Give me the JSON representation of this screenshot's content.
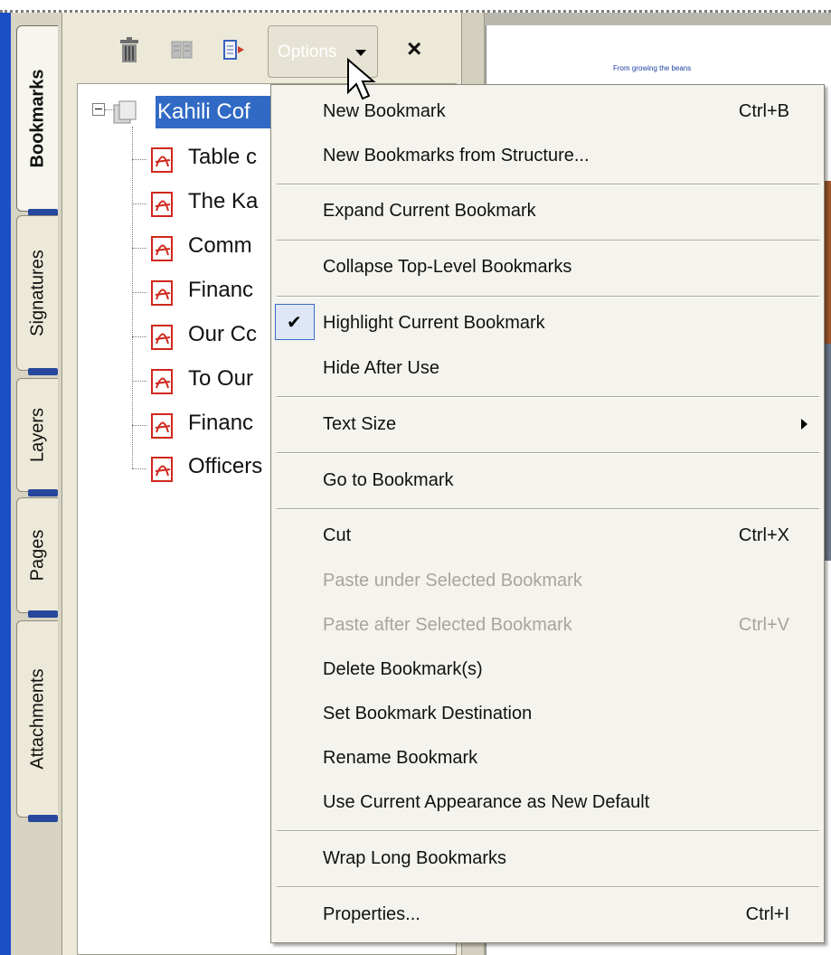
{
  "side_tabs": [
    {
      "label": "Bookmarks",
      "active": true
    },
    {
      "label": "Signatures",
      "active": false
    },
    {
      "label": "Layers",
      "active": false
    },
    {
      "label": "Pages",
      "active": false
    },
    {
      "label": "Attachments",
      "active": false
    }
  ],
  "toolbar": {
    "delete_icon": "trash-icon",
    "expand_icon": "expand-bookmark-icon",
    "new_icon": "new-bookmark-icon",
    "options_label": "Options",
    "close_label": "×"
  },
  "tree": {
    "root": {
      "label": "Kahili Cof",
      "icon": "document-icon",
      "expanded": true
    },
    "items": [
      {
        "label": "Table c"
      },
      {
        "label": "The Ka"
      },
      {
        "label": "Comm"
      },
      {
        "label": "Financ"
      },
      {
        "label": "Our Cc"
      },
      {
        "label": "To Our"
      },
      {
        "label": "Financ"
      },
      {
        "label": "Officers"
      }
    ]
  },
  "document": {
    "heading_text": "From growing the beans"
  },
  "menu": {
    "items": [
      {
        "label": "New Bookmark",
        "shortcut": "Ctrl+B"
      },
      {
        "label": "New Bookmarks from Structure...",
        "shortcut": ""
      },
      {
        "label": "Expand Current Bookmark",
        "shortcut": ""
      },
      {
        "label": "Collapse Top-Level Bookmarks",
        "shortcut": ""
      },
      {
        "label": "Highlight Current Bookmark",
        "shortcut": "",
        "checked": true
      },
      {
        "label": "Hide After Use",
        "shortcut": ""
      },
      {
        "label": "Text Size",
        "shortcut": "",
        "submenu": true
      },
      {
        "label": "Go to Bookmark",
        "shortcut": ""
      },
      {
        "label": "Cut",
        "shortcut": "Ctrl+X"
      },
      {
        "label": "Paste under Selected Bookmark",
        "shortcut": "",
        "disabled": true
      },
      {
        "label": "Paste after Selected Bookmark",
        "shortcut": "Ctrl+V",
        "disabled": true
      },
      {
        "label": "Delete Bookmark(s)",
        "shortcut": ""
      },
      {
        "label": "Set Bookmark Destination",
        "shortcut": ""
      },
      {
        "label": "Rename Bookmark",
        "shortcut": ""
      },
      {
        "label": "Use Current Appearance as New Default",
        "shortcut": ""
      },
      {
        "label": "Wrap Long Bookmarks",
        "shortcut": ""
      },
      {
        "label": "Properties...",
        "shortcut": "Ctrl+I"
      }
    ],
    "check_glyph": "✔"
  },
  "colors": {
    "selection": "#316ac5",
    "accent_blue": "#1b4fc4",
    "menu_bg": "#f4f3ee",
    "disabled_text": "#a7a59c"
  }
}
